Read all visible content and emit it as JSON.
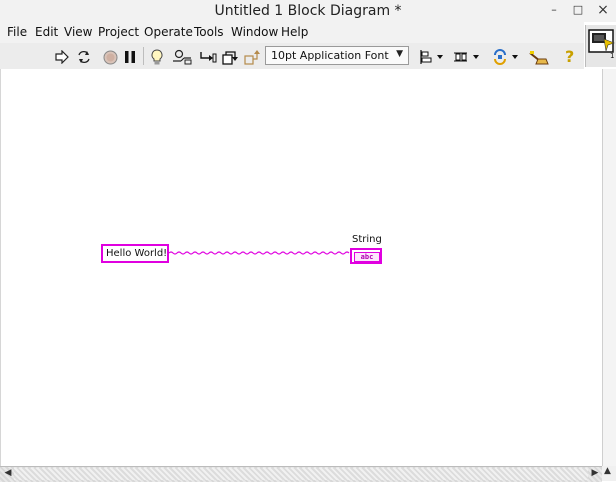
{
  "window": {
    "title": "Untitled 1 Block Diagram *",
    "controls": {
      "minimize": "–",
      "maximize": "□",
      "close": "×"
    }
  },
  "menu": {
    "items": [
      "File",
      "Edit",
      "View",
      "Project",
      "Operate",
      "Tools",
      "Window",
      "Help"
    ]
  },
  "toolbar": {
    "font_selector": "10pt Application Font",
    "icons": [
      "run-arrow-icon",
      "run-continuously-icon",
      "abort-icon",
      "pause-icon",
      "highlight-execution-icon",
      "retain-wire-values-icon",
      "step-into-icon",
      "step-over-icon",
      "step-out-icon",
      "align-objects-icon",
      "distribute-objects-icon",
      "reorder-icon",
      "cleanup-diagram-icon",
      "help-icon"
    ]
  },
  "diagram": {
    "string_constant": "Hello World!",
    "indicator_label": "String",
    "indicator_terminal": "abc",
    "wire_color": "#e000e0"
  }
}
